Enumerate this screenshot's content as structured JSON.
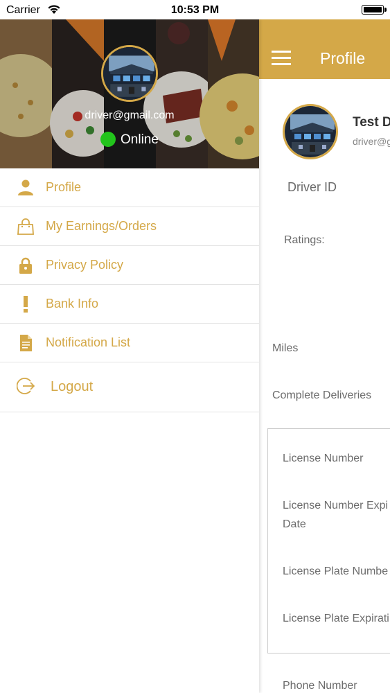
{
  "status_bar": {
    "carrier": "Carrier",
    "time": "10:53 PM"
  },
  "colors": {
    "accent": "#d4a848",
    "online": "#22c41c",
    "label_gray": "#6b6b6b"
  },
  "drawer": {
    "email": "driver@gmail.com",
    "status": "Online",
    "menu": [
      {
        "label": "Profile",
        "icon": "person-icon"
      },
      {
        "label": "My Earnings/Orders",
        "icon": "shopping-bag-icon"
      },
      {
        "label": "Privacy Policy",
        "icon": "lock-icon"
      },
      {
        "label": "Bank Info",
        "icon": "exclamation-icon"
      },
      {
        "label": "Notification List",
        "icon": "document-icon"
      },
      {
        "label": "Logout",
        "icon": "logout-icon"
      }
    ]
  },
  "profile": {
    "title": "Profile",
    "name": "Test D",
    "email": "driver@g",
    "labels": {
      "driver_id": "Driver ID",
      "ratings": "Ratings:",
      "miles": "Miles",
      "complete_deliveries": "Complete Deliveries",
      "license_number": "License Number",
      "license_expiry_line1": "License Number Expi",
      "license_expiry_line2": "Date",
      "license_plate_number": "License Plate Numbe",
      "license_plate_expiration": "License Plate Expirati",
      "phone_number": "Phone Number"
    }
  }
}
